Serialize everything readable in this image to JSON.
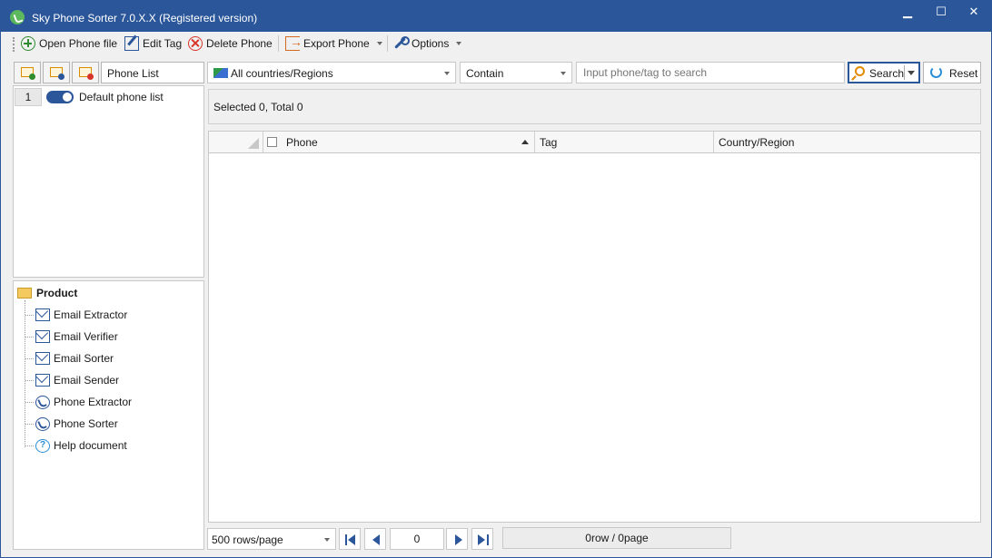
{
  "window": {
    "title": "Sky Phone Sorter 7.0.X.X (Registered version)",
    "controls": {
      "minimize": "▁",
      "maximize": "☐",
      "close": "✕"
    }
  },
  "toolbar": {
    "open_phone_file": "Open Phone file",
    "edit_tag": "Edit Tag",
    "delete_phone": "Delete Phone",
    "export_phone": "Export Phone",
    "options": "Options"
  },
  "left_panel": {
    "list_header_label": "Phone List",
    "lists": [
      {
        "number": "1",
        "enabled": true,
        "name": "Default phone list"
      }
    ]
  },
  "product_tree": {
    "root": "Product",
    "items": [
      {
        "label": "Email Extractor",
        "icon": "mail-icon"
      },
      {
        "label": "Email Verifier",
        "icon": "mail-icon"
      },
      {
        "label": "Email Sorter",
        "icon": "mail-icon"
      },
      {
        "label": "Email Sender",
        "icon": "mail-icon"
      },
      {
        "label": "Phone Extractor",
        "icon": "phone-icon"
      },
      {
        "label": "Phone Sorter",
        "icon": "phone-icon"
      },
      {
        "label": "Help document",
        "icon": "help-icon"
      }
    ]
  },
  "search_bar": {
    "region_value": "All countries/Regions",
    "match_value": "Contain",
    "input_value": "",
    "input_placeholder": "Input phone/tag to search",
    "search_label": "Search",
    "reset_label": "Reset"
  },
  "status": {
    "text": "Selected 0, Total 0"
  },
  "grid": {
    "columns": [
      "Phone",
      "Tag",
      "Country/Region"
    ],
    "sort_column": "Phone",
    "sort_direction": "ascending",
    "rows": []
  },
  "pager": {
    "rows_per_page": "500 rows/page",
    "current_page": "0",
    "info": "0row / 0page"
  },
  "colors": {
    "accent": "#2b579a",
    "window_bg": "#f0f0f0",
    "delete_red": "#d9342b",
    "add_green": "#2e8b2e"
  }
}
